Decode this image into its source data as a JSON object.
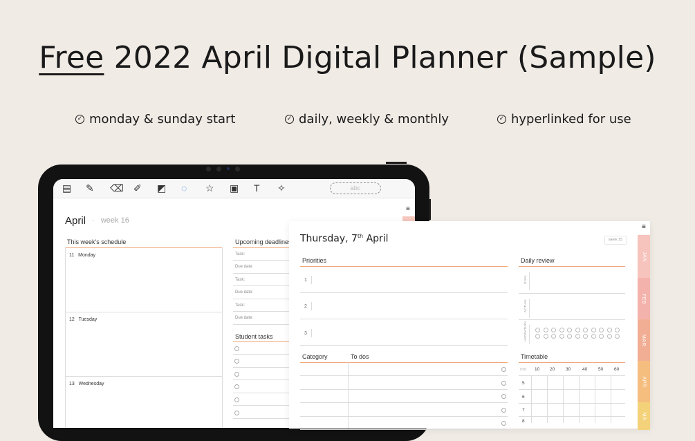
{
  "headline": {
    "emphasis": "Free",
    "rest": "2022 April Digital Planner (Sample)"
  },
  "features": [
    {
      "label": "monday & sunday start"
    },
    {
      "label": "daily, weekly & monthly"
    },
    {
      "label": "hyperlinked for use"
    }
  ],
  "toolbar": {
    "pen_placeholder": "abc"
  },
  "weekly": {
    "month": "April",
    "separator": "·",
    "week": "week 16",
    "schedule_title": "This week's schedule",
    "days": [
      {
        "num": "11",
        "name": "Monday"
      },
      {
        "num": "12",
        "name": "Tuesday"
      },
      {
        "num": "13",
        "name": "Wednesday"
      }
    ],
    "deadlines_title": "Upcoming deadlines",
    "deadline_rows": [
      "Task:",
      "Due date:",
      "Task:",
      "Due date:",
      "Task:",
      "Due date:"
    ],
    "student_tasks_title": "Student tasks"
  },
  "daily": {
    "title_prefix": "Thursday, 7",
    "title_sup": "th",
    "title_suffix": " April",
    "week_badge": "week 15",
    "menu_icon": "≡",
    "priorities_title": "Priorities",
    "priority_numbers": [
      "1",
      "2",
      "3"
    ],
    "review_title": "Daily review",
    "review_labels": [
      "GOAL",
      "ACTUAL",
      "HYDRATION"
    ],
    "category_title": "Category",
    "todos_title": "To dos",
    "timetable_title": "Timetable",
    "timetable_minutes": [
      "10",
      "20",
      "30",
      "40",
      "50",
      "60"
    ],
    "timetable_corner": "H/M",
    "timetable_hours": [
      "5",
      "6",
      "7",
      "8"
    ],
    "month_tabs": [
      {
        "label": "JAN",
        "color": "#f7c3bd"
      },
      {
        "label": "FEB",
        "color": "#f3b2ab"
      },
      {
        "label": "MAR",
        "color": "#f2ae94"
      },
      {
        "label": "APR",
        "color": "#f5be7f"
      },
      {
        "label": "MA",
        "color": "#f4d27a"
      }
    ]
  },
  "colors": {
    "accent": "#f0a97a",
    "background": "#f0ebe5"
  }
}
